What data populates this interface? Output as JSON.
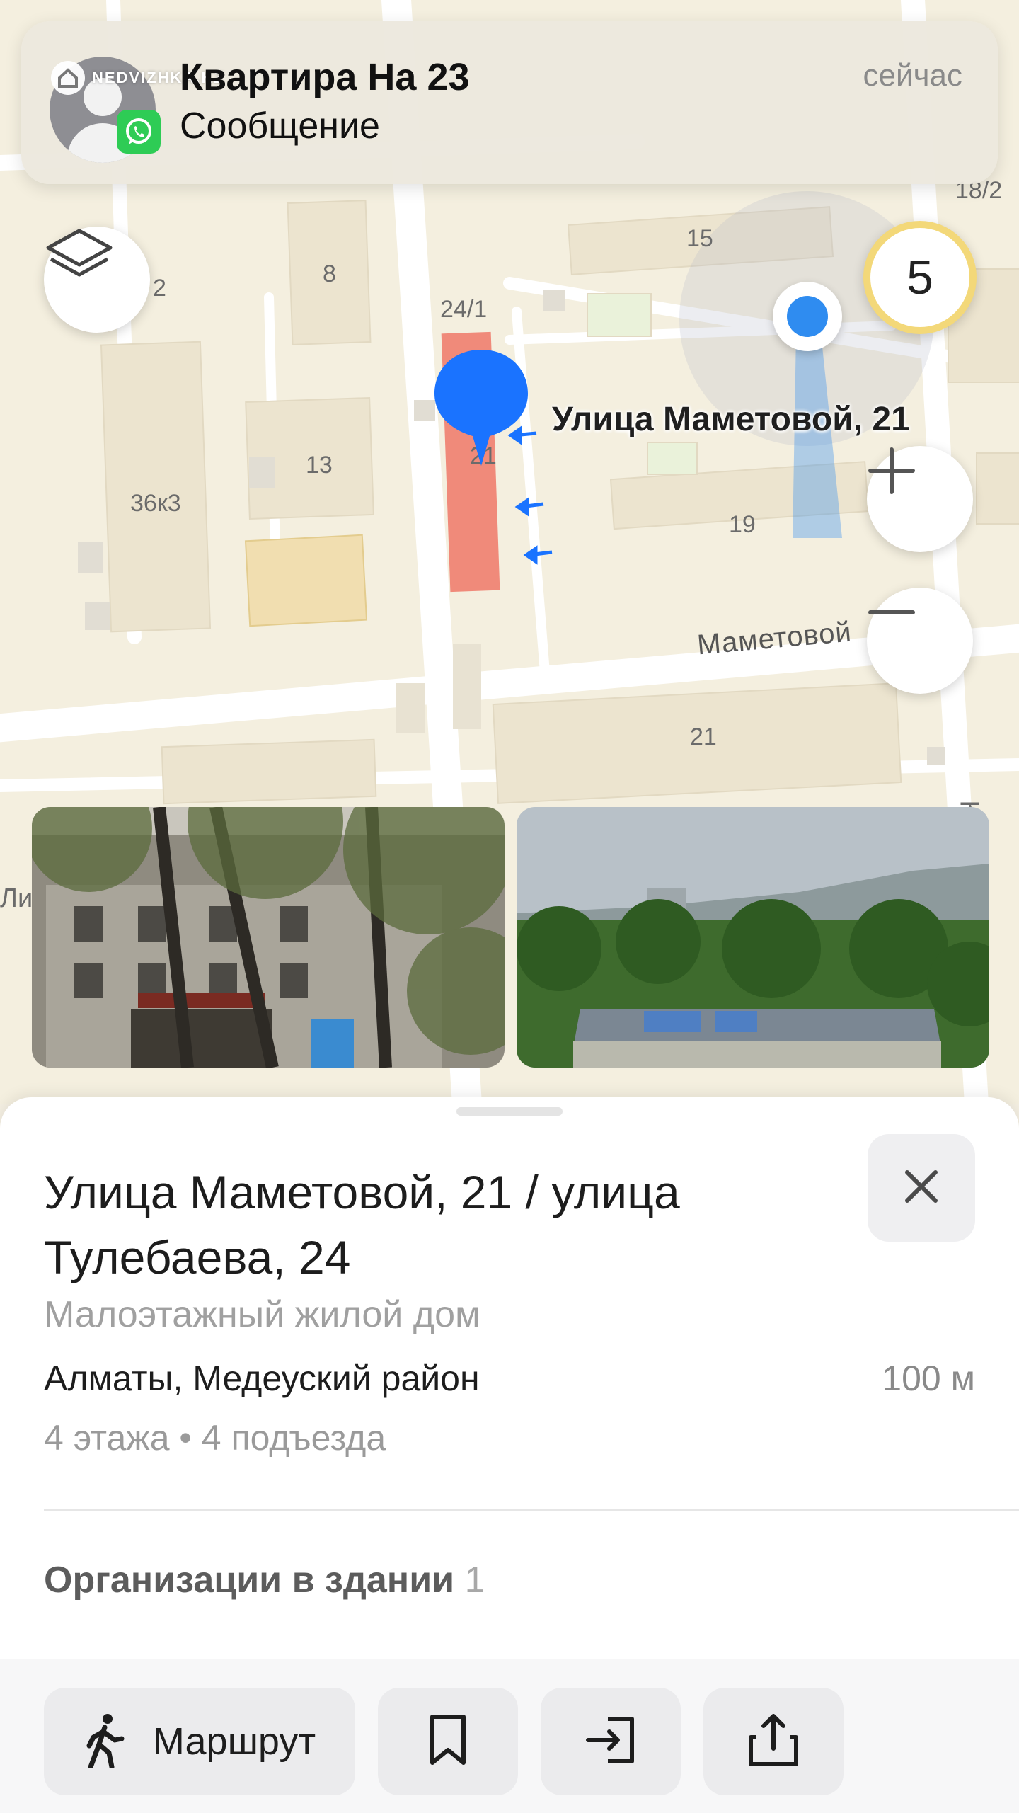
{
  "notification": {
    "title": "Квартира На 23",
    "message": "Сообщение",
    "time": "сейчас",
    "app_icon": "whatsapp-icon",
    "watermark": "NEDVIZHKA.KZ"
  },
  "map": {
    "speed_limit": "5",
    "pin_label": "Улица Маметовой, 21",
    "street_label": "Маметовой",
    "building_numbers": [
      "8",
      "15",
      "18/2",
      "24/1",
      "13",
      "36к3",
      "19",
      "21",
      "2",
      "21"
    ],
    "edge_labels": [
      "Ли",
      "К"
    ],
    "controls": [
      "layers-icon",
      "plus-icon",
      "minus-icon"
    ],
    "colors": {
      "pin": "#1a73ff",
      "selected_building": "#f08a7a",
      "user_location": "#2f8cf0"
    }
  },
  "photos": [
    {
      "name": "building-photo"
    },
    {
      "name": "view-photo"
    }
  ],
  "place": {
    "title": "Улица Маметовой, 21 / улица Тулебаева, 24",
    "type": "Малоэтажный жилой дом",
    "city": "Алматы, Медеуский район",
    "distance": "100 м",
    "meta": "4 этажа • 4 подъезда",
    "orgs_label": "Организации в здании",
    "orgs_count": "1"
  },
  "actions": {
    "route_label": "Маршрут",
    "icons": [
      "walker-icon",
      "bookmark-icon",
      "enter-icon",
      "share-icon"
    ]
  }
}
